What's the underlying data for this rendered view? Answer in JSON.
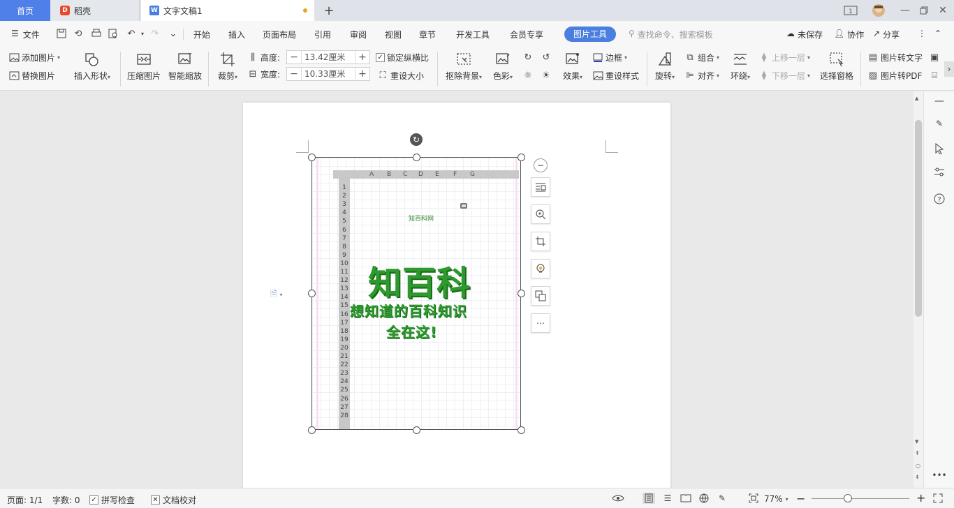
{
  "tabs": {
    "home": "首页",
    "daoke": "稻壳",
    "doc": "文字文稿1",
    "page_badge": "1"
  },
  "menu": {
    "file": "文件",
    "items": [
      "开始",
      "插入",
      "页面布局",
      "引用",
      "审阅",
      "视图",
      "章节",
      "开发工具",
      "会员专享"
    ],
    "picture_tools": "图片工具",
    "search_placeholder": "查找命令、搜索模板",
    "unsaved": "未保存",
    "collab": "协作",
    "share": "分享"
  },
  "ribbon": {
    "add_picture": "添加图片",
    "replace_picture": "替换图片",
    "insert_shape": "插入形状",
    "compress_picture": "压缩图片",
    "smart_scale": "智能缩放",
    "crop": "裁剪",
    "height_label": "高度:",
    "height_value": "13.42厘米",
    "width_label": "宽度:",
    "width_value": "10.33厘米",
    "lock_ratio": "锁定纵横比",
    "reset_size": "重设大小",
    "remove_bg": "抠除背景",
    "color": "色彩",
    "effects": "效果",
    "border": "边框",
    "reset_style": "重设样式",
    "rotate": "旋转",
    "group": "组合",
    "align": "对齐",
    "wrap": "环绕",
    "bring_forward": "上移一层",
    "send_backward": "下移一层",
    "selection_pane": "选择窗格",
    "pic_to_text": "图片转文字",
    "pic_to_pdf": "图片转PDF"
  },
  "image": {
    "columns": [
      "A",
      "B",
      "C",
      "D",
      "E",
      "F",
      "G"
    ],
    "rows": [
      "1",
      "2",
      "3",
      "4",
      "5",
      "6",
      "7",
      "8",
      "9",
      "10",
      "11",
      "12",
      "13",
      "14",
      "15",
      "16",
      "17",
      "18",
      "19",
      "20",
      "21",
      "22",
      "23",
      "24",
      "25",
      "26",
      "27",
      "28"
    ],
    "small_title": "知百科网",
    "big_title": "知百科",
    "subtitle_1": "想知道的百科知识",
    "subtitle_2": "全在这!"
  },
  "status": {
    "page": "页面: 1/1",
    "words": "字数: 0",
    "spell_check": "拼写检查",
    "doc_proof": "文档校对",
    "zoom": "77%"
  },
  "colors": {
    "accent": "#4a7fe0",
    "green_text": "#2e9a2e"
  }
}
